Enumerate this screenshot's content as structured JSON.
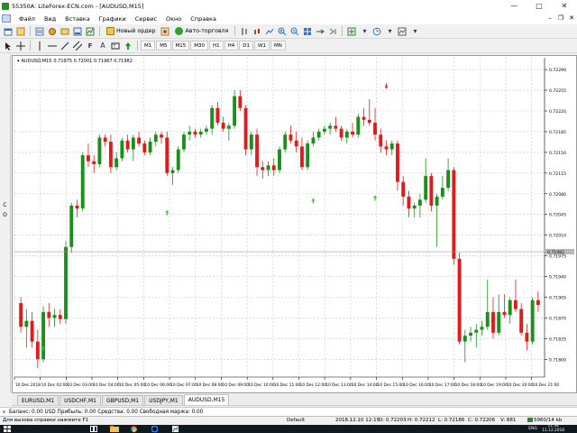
{
  "window": {
    "title": "55350A: LiteForex-ECN.com - [AUDUSD,M15]",
    "minimize": "—",
    "maximize": "□",
    "close": "✕"
  },
  "menu": {
    "items": [
      "Файл",
      "Вид",
      "Вставка",
      "Графики",
      "Сервис",
      "Окно",
      "Справка"
    ],
    "mdi_minimize": "–",
    "mdi_restore": "❐",
    "mdi_close": "✕"
  },
  "toolbar": {
    "new_order": "Новый ордер",
    "auto_trading": "Авто-торговля",
    "timeframes": [
      "M1",
      "M5",
      "M15",
      "M30",
      "H1",
      "H4",
      "D1",
      "W1",
      "MN"
    ]
  },
  "left_panel": {
    "labels": [
      "C",
      "O"
    ]
  },
  "chart": {
    "header_symbol": "AUDUSD,M15",
    "header_values": "0.71975 0.72001 0.71967 0.71982",
    "current_price_label": "0.71982",
    "colors": {
      "bull": "#1a8f1a",
      "bear": "#e21a1a",
      "signal_up": "#26c826",
      "signal_down": "#e21a1a",
      "grid": "#c8c8c8"
    }
  },
  "chart_data": {
    "type": "candlestick",
    "symbol": "AUDUSD",
    "timeframe": "M15",
    "ylim": [
      0.7177,
      0.7231
    ],
    "yticks": [
      "0.72290",
      "0.72255",
      "0.72220",
      "0.72185",
      "0.72150",
      "0.72115",
      "0.72080",
      "0.72045",
      "0.72010",
      "0.71975",
      "0.71940",
      "0.71905",
      "0.71870",
      "0.71835",
      "0.71800",
      "0.71765"
    ],
    "xticks": [
      "10 Dec 2018",
      "10 Dec 02:00",
      "10 Dec 03:00",
      "10 Dec 04:00",
      "10 Dec 05:00",
      "10 Dec 06:00",
      "10 Dec 07:00",
      "10 Dec 08:00",
      "10 Dec 09:00",
      "10 Dec 10:00",
      "10 Dec 11:00",
      "10 Dec 12:00",
      "10 Dec 13:00",
      "10 Dec 14:00",
      "10 Dec 15:00",
      "10 Dec 16:00",
      "10 Dec 17:00",
      "10 Dec 18:00",
      "10 Dec 19:00",
      "10 Dec 20:00",
      "10 Dec 21:00"
    ],
    "ohlc": [
      [
        0.71895,
        0.71905,
        0.71845,
        0.71855
      ],
      [
        0.71855,
        0.71885,
        0.7182,
        0.71865
      ],
      [
        0.71865,
        0.7188,
        0.7182,
        0.7183
      ],
      [
        0.7183,
        0.7185,
        0.71785,
        0.718
      ],
      [
        0.718,
        0.7189,
        0.71795,
        0.7188
      ],
      [
        0.7188,
        0.71895,
        0.71855,
        0.7187
      ],
      [
        0.7187,
        0.71885,
        0.71855,
        0.71875
      ],
      [
        0.71875,
        0.71885,
        0.7186,
        0.71868
      ],
      [
        0.71868,
        0.72,
        0.7186,
        0.7199
      ],
      [
        0.7199,
        0.72065,
        0.7198,
        0.7206
      ],
      [
        0.7206,
        0.7207,
        0.7204,
        0.72055
      ],
      [
        0.72055,
        0.7215,
        0.7205,
        0.72145
      ],
      [
        0.72145,
        0.72165,
        0.72125,
        0.72135
      ],
      [
        0.72135,
        0.72145,
        0.72115,
        0.7213
      ],
      [
        0.7213,
        0.7218,
        0.72125,
        0.72175
      ],
      [
        0.72175,
        0.7218,
        0.7216,
        0.72168
      ],
      [
        0.72168,
        0.7218,
        0.72115,
        0.72125
      ],
      [
        0.72125,
        0.7215,
        0.7212,
        0.7214
      ],
      [
        0.7214,
        0.72175,
        0.72135,
        0.7217
      ],
      [
        0.7217,
        0.7218,
        0.7215,
        0.72155
      ],
      [
        0.72155,
        0.7218,
        0.72135,
        0.72175
      ],
      [
        0.72175,
        0.72185,
        0.7216,
        0.72165
      ],
      [
        0.72165,
        0.7217,
        0.72145,
        0.7215
      ],
      [
        0.7215,
        0.72175,
        0.72145,
        0.72168
      ],
      [
        0.72168,
        0.72185,
        0.7216,
        0.7218
      ],
      [
        0.7218,
        0.72185,
        0.72165,
        0.72175
      ],
      [
        0.72175,
        0.72185,
        0.7211,
        0.72115
      ],
      [
        0.72115,
        0.72125,
        0.72095,
        0.7212
      ],
      [
        0.7212,
        0.7216,
        0.72115,
        0.72155
      ],
      [
        0.72155,
        0.72185,
        0.7215,
        0.7218
      ],
      [
        0.7218,
        0.72195,
        0.7217,
        0.72185
      ],
      [
        0.72185,
        0.7219,
        0.72175,
        0.7218
      ],
      [
        0.7218,
        0.7219,
        0.72175,
        0.72185
      ],
      [
        0.72185,
        0.72195,
        0.7218,
        0.7219
      ],
      [
        0.7219,
        0.7223,
        0.7218,
        0.72225
      ],
      [
        0.72225,
        0.72235,
        0.72195,
        0.722
      ],
      [
        0.722,
        0.7221,
        0.72185,
        0.7219
      ],
      [
        0.7219,
        0.722,
        0.7217,
        0.72195
      ],
      [
        0.72195,
        0.72255,
        0.7219,
        0.72245
      ],
      [
        0.72245,
        0.72255,
        0.7222,
        0.72225
      ],
      [
        0.72225,
        0.7223,
        0.72145,
        0.72155
      ],
      [
        0.72155,
        0.72185,
        0.72145,
        0.7218
      ],
      [
        0.7218,
        0.7219,
        0.7211,
        0.72125
      ],
      [
        0.72125,
        0.72135,
        0.72105,
        0.7212
      ],
      [
        0.7212,
        0.72135,
        0.7211,
        0.72128
      ],
      [
        0.72128,
        0.7214,
        0.7211,
        0.7212
      ],
      [
        0.7212,
        0.7216,
        0.72115,
        0.72155
      ],
      [
        0.72155,
        0.72185,
        0.7215,
        0.7218
      ],
      [
        0.7218,
        0.72195,
        0.72165,
        0.7217
      ],
      [
        0.7217,
        0.72185,
        0.7215,
        0.7216
      ],
      [
        0.7216,
        0.72175,
        0.7212,
        0.72125
      ],
      [
        0.72125,
        0.7217,
        0.7212,
        0.72165
      ],
      [
        0.72165,
        0.72185,
        0.7216,
        0.72175
      ],
      [
        0.72175,
        0.7219,
        0.7217,
        0.72185
      ],
      [
        0.72185,
        0.72195,
        0.7218,
        0.7219
      ],
      [
        0.7219,
        0.722,
        0.7218,
        0.72195
      ],
      [
        0.72195,
        0.7221,
        0.72185,
        0.7219
      ],
      [
        0.7219,
        0.72195,
        0.7217,
        0.72175
      ],
      [
        0.72175,
        0.7219,
        0.72165,
        0.72185
      ],
      [
        0.72185,
        0.722,
        0.72175,
        0.7218
      ],
      [
        0.7218,
        0.72215,
        0.72175,
        0.7221
      ],
      [
        0.7221,
        0.72225,
        0.72195,
        0.72205
      ],
      [
        0.72205,
        0.7224,
        0.72195,
        0.722
      ],
      [
        0.722,
        0.72225,
        0.7217,
        0.7218
      ],
      [
        0.7218,
        0.7219,
        0.7215,
        0.7216
      ],
      [
        0.7216,
        0.7217,
        0.72145,
        0.72155
      ],
      [
        0.72155,
        0.7217,
        0.72145,
        0.72165
      ],
      [
        0.72165,
        0.7217,
        0.72085,
        0.721
      ],
      [
        0.721,
        0.7211,
        0.7206,
        0.72075
      ],
      [
        0.72075,
        0.72085,
        0.7204,
        0.72055
      ],
      [
        0.72055,
        0.72065,
        0.7204,
        0.7206
      ],
      [
        0.7206,
        0.7208,
        0.7204,
        0.7207
      ],
      [
        0.7207,
        0.7214,
        0.72065,
        0.7211
      ],
      [
        0.7211,
        0.72115,
        0.7205,
        0.7206
      ],
      [
        0.7206,
        0.7208,
        0.7199,
        0.72075
      ],
      [
        0.72075,
        0.7211,
        0.7207,
        0.7209
      ],
      [
        0.7209,
        0.7214,
        0.72085,
        0.7212
      ],
      [
        0.7212,
        0.72125,
        0.7196,
        0.7197
      ],
      [
        0.7197,
        0.7198,
        0.71825,
        0.7183
      ],
      [
        0.7183,
        0.7185,
        0.71795,
        0.7184
      ],
      [
        0.7184,
        0.71855,
        0.7183,
        0.71845
      ],
      [
        0.71845,
        0.7186,
        0.7182,
        0.7185
      ],
      [
        0.7185,
        0.71865,
        0.7184,
        0.71855
      ],
      [
        0.71855,
        0.71935,
        0.7185,
        0.7188
      ],
      [
        0.7188,
        0.71905,
        0.71835,
        0.71845
      ],
      [
        0.71845,
        0.7191,
        0.7184,
        0.7188
      ],
      [
        0.7188,
        0.7191,
        0.7187,
        0.71875
      ],
      [
        0.71875,
        0.71905,
        0.7186,
        0.719
      ],
      [
        0.719,
        0.71935,
        0.7188,
        0.71885
      ],
      [
        0.71885,
        0.71895,
        0.7184,
        0.71845
      ],
      [
        0.71845,
        0.7186,
        0.71815,
        0.7183
      ],
      [
        0.7183,
        0.71905,
        0.71825,
        0.719
      ],
      [
        0.719,
        0.71915,
        0.7188,
        0.71892
      ]
    ],
    "signals": [
      {
        "dir": "up",
        "index": 4,
        "price": 0.71818
      },
      {
        "dir": "up",
        "index": 26,
        "price": 0.72048
      },
      {
        "dir": "down",
        "index": 40,
        "price": 0.72218
      },
      {
        "dir": "up",
        "index": 52,
        "price": 0.72068
      },
      {
        "dir": "up",
        "index": 63,
        "price": 0.72073
      },
      {
        "dir": "down",
        "index": 65,
        "price": 0.72262
      }
    ],
    "current_price": 0.71982
  },
  "tabs": [
    "EURUSD,M1",
    "USDCHF,M1",
    "GBPUSD,M1",
    "USDJPY,M1",
    "AUDUSD,M15"
  ],
  "active_tab": "AUDUSD,M15",
  "terminal": {
    "close": "x",
    "text": "Баланс: 0.00 USD  Прибыль: 0.00  Средства: 0.00  Свободная маржа: 0.00"
  },
  "status": {
    "help": "Для вызова справки нажмите F1",
    "profile": "Default",
    "datetime": "2018.12.10 12:15",
    "open": "O: 0.72203",
    "high": "H: 0.72212",
    "low": "L: 0.72186",
    "close": "C: 0.72206",
    "volume": "V: 881",
    "traffic": "5960/14 kb"
  },
  "taskbar": {
    "lang": "ENG",
    "time": "11:34",
    "date": "11.12.2018"
  }
}
